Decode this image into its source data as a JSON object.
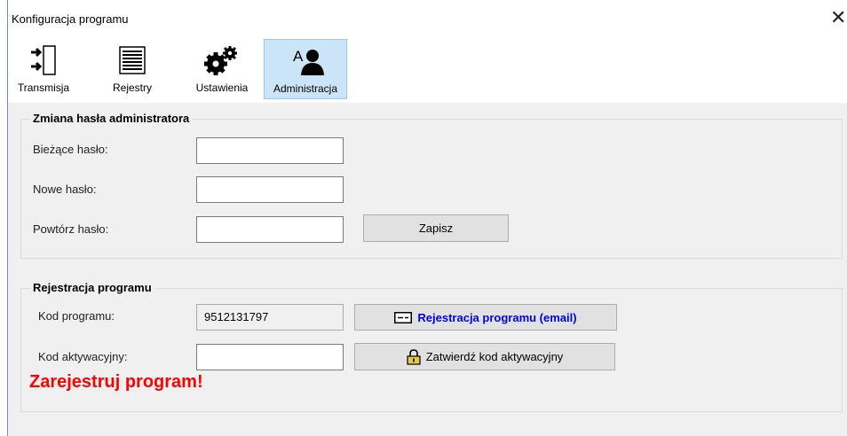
{
  "window": {
    "title": "Konfiguracja programu",
    "close_label": "✕"
  },
  "toolbar": {
    "items": [
      {
        "label": "Transmisja",
        "icon": "transmission-icon"
      },
      {
        "label": "Rejestry",
        "icon": "list-icon"
      },
      {
        "label": "Ustawienia",
        "icon": "gears-icon"
      },
      {
        "label": "Administracja",
        "icon": "admin-user-icon",
        "active": true
      }
    ]
  },
  "password_group": {
    "legend": "Zmiana hasła administratora",
    "current_label": "Bieżące hasło:",
    "current_value": "",
    "new_label": "Nowe hasło:",
    "new_value": "",
    "repeat_label": "Powtórz hasło:",
    "repeat_value": "",
    "save_label": "Zapisz"
  },
  "registration_group": {
    "legend": "Rejestracja programu",
    "code_label": "Kod programu:",
    "code_value": "9512131797",
    "email_button_label": "Rejestracja programu (email)",
    "activation_label": "Kod aktywacyjny:",
    "activation_value": "",
    "confirm_button_label": "Zatwierdź kod aktywacyjny",
    "warning": "Zarejestruj program!"
  },
  "colors": {
    "warning": "#ff0000",
    "link": "#0000ee",
    "active_tab": "#cce4f7"
  }
}
